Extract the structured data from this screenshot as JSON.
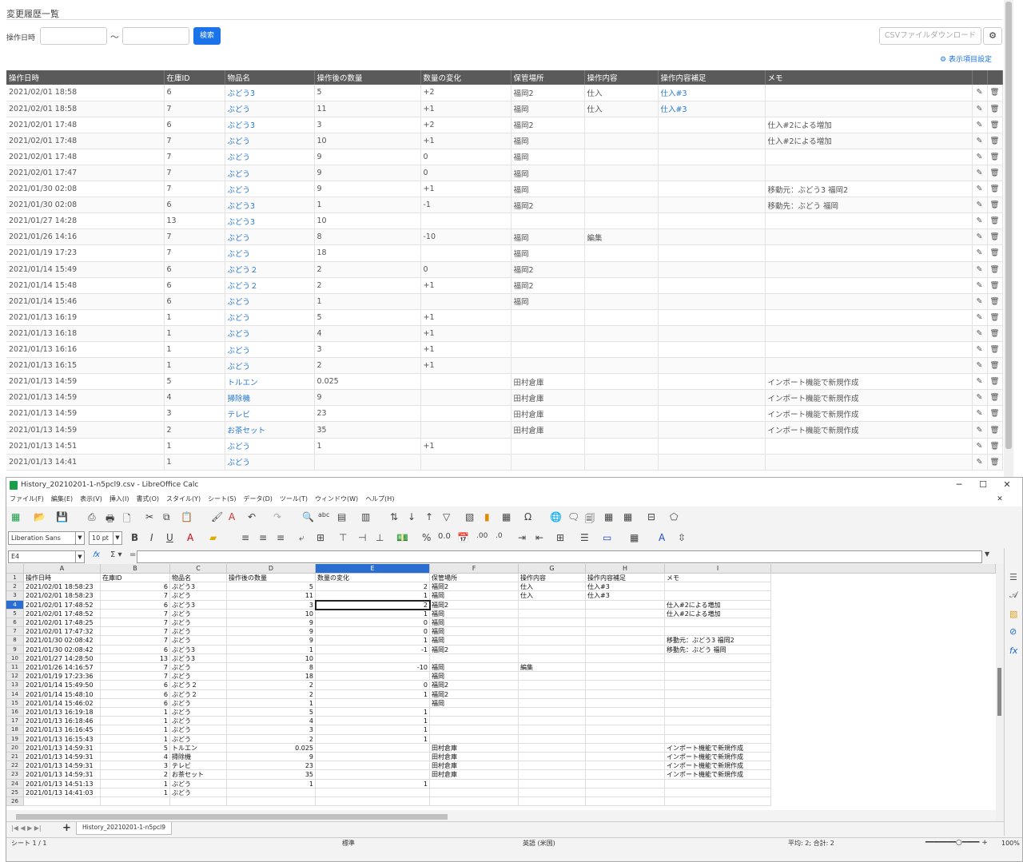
{
  "web": {
    "page_title": "変更履歴一覧",
    "filter_label": "操作日時",
    "tilde": "〜",
    "search_button": "検索",
    "csv_button": "CSVファイルダウンロード",
    "display_settings": "表示項目設定",
    "columns": [
      "操作日時",
      "在庫ID",
      "物品名",
      "操作後の数量",
      "数量の変化",
      "保管場所",
      "操作内容",
      "操作内容補足",
      "メモ"
    ],
    "rows": [
      [
        "2021/02/01 18:58",
        "6",
        "ぶどう3",
        "5",
        "+2",
        "福岡2",
        "仕入",
        "仕入#3",
        ""
      ],
      [
        "2021/02/01 18:58",
        "7",
        "ぶどう",
        "11",
        "+1",
        "福岡",
        "仕入",
        "仕入#3",
        ""
      ],
      [
        "2021/02/01 17:48",
        "6",
        "ぶどう3",
        "3",
        "+2",
        "福岡2",
        "",
        "",
        "仕入#2による増加"
      ],
      [
        "2021/02/01 17:48",
        "7",
        "ぶどう",
        "10",
        "+1",
        "福岡",
        "",
        "",
        "仕入#2による増加"
      ],
      [
        "2021/02/01 17:48",
        "7",
        "ぶどう",
        "9",
        "0",
        "福岡",
        "",
        "",
        ""
      ],
      [
        "2021/02/01 17:47",
        "7",
        "ぶどう",
        "9",
        "0",
        "福岡",
        "",
        "",
        ""
      ],
      [
        "2021/01/30 02:08",
        "7",
        "ぶどう",
        "9",
        "+1",
        "福岡",
        "",
        "",
        "移動元：ぶどう3 福岡2"
      ],
      [
        "2021/01/30 02:08",
        "6",
        "ぶどう3",
        "1",
        "-1",
        "福岡2",
        "",
        "",
        "移動先：ぶどう 福岡"
      ],
      [
        "2021/01/27 14:28",
        "13",
        "ぶどう3",
        "10",
        "",
        "",
        "",
        "",
        ""
      ],
      [
        "2021/01/26 14:16",
        "7",
        "ぶどう",
        "8",
        "-10",
        "福岡",
        "編集",
        "",
        ""
      ],
      [
        "2021/01/19 17:23",
        "7",
        "ぶどう",
        "18",
        "",
        "福岡",
        "",
        "",
        ""
      ],
      [
        "2021/01/14 15:49",
        "6",
        "ぶどう２",
        "2",
        "0",
        "福岡2",
        "",
        "",
        ""
      ],
      [
        "2021/01/14 15:48",
        "6",
        "ぶどう２",
        "2",
        "+1",
        "福岡2",
        "",
        "",
        ""
      ],
      [
        "2021/01/14 15:46",
        "6",
        "ぶどう",
        "1",
        "",
        "福岡",
        "",
        "",
        ""
      ],
      [
        "2021/01/13 16:19",
        "1",
        "ぶどう",
        "5",
        "+1",
        "",
        "",
        "",
        ""
      ],
      [
        "2021/01/13 16:18",
        "1",
        "ぶどう",
        "4",
        "+1",
        "",
        "",
        "",
        ""
      ],
      [
        "2021/01/13 16:16",
        "1",
        "ぶどう",
        "3",
        "+1",
        "",
        "",
        "",
        ""
      ],
      [
        "2021/01/13 16:15",
        "1",
        "ぶどう",
        "2",
        "+1",
        "",
        "",
        "",
        ""
      ],
      [
        "2021/01/13 14:59",
        "5",
        "トルエン",
        "0.025",
        "",
        "田村倉庫",
        "",
        "",
        "インポート機能で新規作成"
      ],
      [
        "2021/01/13 14:59",
        "4",
        "掃除機",
        "9",
        "",
        "田村倉庫",
        "",
        "",
        "インポート機能で新規作成"
      ],
      [
        "2021/01/13 14:59",
        "3",
        "テレビ",
        "23",
        "",
        "田村倉庫",
        "",
        "",
        "インポート機能で新規作成"
      ],
      [
        "2021/01/13 14:59",
        "2",
        "お茶セット",
        "35",
        "",
        "田村倉庫",
        "",
        "",
        "インポート機能で新規作成"
      ],
      [
        "2021/01/13 14:51",
        "1",
        "ぶどう",
        "1",
        "+1",
        "",
        "",
        "",
        ""
      ],
      [
        "2021/01/13 14:41",
        "1",
        "ぶどう",
        "",
        "",
        "",
        "",
        "",
        ""
      ]
    ]
  },
  "calc": {
    "window_title": "History_20210201-1-n5pcl9.csv - LibreOffice Calc",
    "menus": [
      "ファイル(F)",
      "編集(E)",
      "表示(V)",
      "挿入(I)",
      "書式(O)",
      "スタイル(Y)",
      "シート(S)",
      "データ(D)",
      "ツール(T)",
      "ウィンドウ(W)",
      "ヘルプ(H)"
    ],
    "font_name": "Liberation Sans",
    "font_size": "10 pt",
    "name_box": "E4",
    "column_letters": [
      "A",
      "B",
      "C",
      "D",
      "E",
      "F",
      "G",
      "H",
      "I"
    ],
    "active_column": "E",
    "active_row": "4",
    "header_row": [
      "操作日時",
      "在庫ID",
      "物品名",
      "操作後の数量",
      "数量の変化",
      "保管場所",
      "操作内容",
      "操作内容補足",
      "メモ"
    ],
    "rows": [
      [
        "2021/02/01 18:58:23",
        "6",
        "ぶどう3",
        "5",
        "2",
        "福岡2",
        "仕入",
        "仕入#3",
        ""
      ],
      [
        "2021/02/01 18:58:23",
        "7",
        "ぶどう",
        "11",
        "1",
        "福岡",
        "仕入",
        "仕入#3",
        ""
      ],
      [
        "2021/02/01 17:48:52",
        "6",
        "ぶどう3",
        "3",
        "2",
        "福岡2",
        "",
        "",
        "仕入#2による増加"
      ],
      [
        "2021/02/01 17:48:52",
        "7",
        "ぶどう",
        "10",
        "1",
        "福岡",
        "",
        "",
        "仕入#2による増加"
      ],
      [
        "2021/02/01 17:48:25",
        "7",
        "ぶどう",
        "9",
        "0",
        "福岡",
        "",
        "",
        ""
      ],
      [
        "2021/02/01 17:47:32",
        "7",
        "ぶどう",
        "9",
        "0",
        "福岡",
        "",
        "",
        ""
      ],
      [
        "2021/01/30 02:08:42",
        "7",
        "ぶどう",
        "9",
        "1",
        "福岡",
        "",
        "",
        "移動元：ぶどう3 福岡2"
      ],
      [
        "2021/01/30 02:08:42",
        "6",
        "ぶどう3",
        "1",
        "-1",
        "福岡2",
        "",
        "",
        "移動先：ぶどう 福岡"
      ],
      [
        "2021/01/27 14:28:50",
        "13",
        "ぶどう3",
        "10",
        "",
        "",
        "",
        "",
        ""
      ],
      [
        "2021/01/26 14:16:57",
        "7",
        "ぶどう",
        "8",
        "-10",
        "福岡",
        "編集",
        "",
        ""
      ],
      [
        "2021/01/19 17:23:36",
        "7",
        "ぶどう",
        "18",
        "",
        "福岡",
        "",
        "",
        ""
      ],
      [
        "2021/01/14 15:49:50",
        "6",
        "ぶどう２",
        "2",
        "0",
        "福岡2",
        "",
        "",
        ""
      ],
      [
        "2021/01/14 15:48:10",
        "6",
        "ぶどう２",
        "2",
        "1",
        "福岡2",
        "",
        "",
        ""
      ],
      [
        "2021/01/14 15:46:02",
        "6",
        "ぶどう",
        "1",
        "",
        "福岡",
        "",
        "",
        ""
      ],
      [
        "2021/01/13 16:19:18",
        "1",
        "ぶどう",
        "5",
        "1",
        "",
        "",
        "",
        ""
      ],
      [
        "2021/01/13 16:18:46",
        "1",
        "ぶどう",
        "4",
        "1",
        "",
        "",
        "",
        ""
      ],
      [
        "2021/01/13 16:16:45",
        "1",
        "ぶどう",
        "3",
        "1",
        "",
        "",
        "",
        ""
      ],
      [
        "2021/01/13 16:15:43",
        "1",
        "ぶどう",
        "2",
        "1",
        "",
        "",
        "",
        ""
      ],
      [
        "2021/01/13 14:59:31",
        "5",
        "トルエン",
        "0.025",
        "",
        "田村倉庫",
        "",
        "",
        "インポート機能で新規作成"
      ],
      [
        "2021/01/13 14:59:31",
        "4",
        "掃除機",
        "9",
        "",
        "田村倉庫",
        "",
        "",
        "インポート機能で新規作成"
      ],
      [
        "2021/01/13 14:59:31",
        "3",
        "テレビ",
        "23",
        "",
        "田村倉庫",
        "",
        "",
        "インポート機能で新規作成"
      ],
      [
        "2021/01/13 14:59:31",
        "2",
        "お茶セット",
        "35",
        "",
        "田村倉庫",
        "",
        "",
        "インポート機能で新規作成"
      ],
      [
        "2021/01/13 14:51:13",
        "1",
        "ぶどう",
        "1",
        "1",
        "",
        "",
        "",
        ""
      ],
      [
        "2021/01/13 14:41:03",
        "1",
        "ぶどう",
        "",
        "",
        "",
        "",
        "",
        ""
      ]
    ],
    "visible_row_count": 26,
    "sheet_tab": "History_20210201-1-n5pcl9",
    "status": {
      "sheet": "シート 1 / 1",
      "page_style": "標準",
      "language": "英語 (米国)",
      "sum": "平均: 2; 合計: 2",
      "zoom": "100%"
    }
  }
}
